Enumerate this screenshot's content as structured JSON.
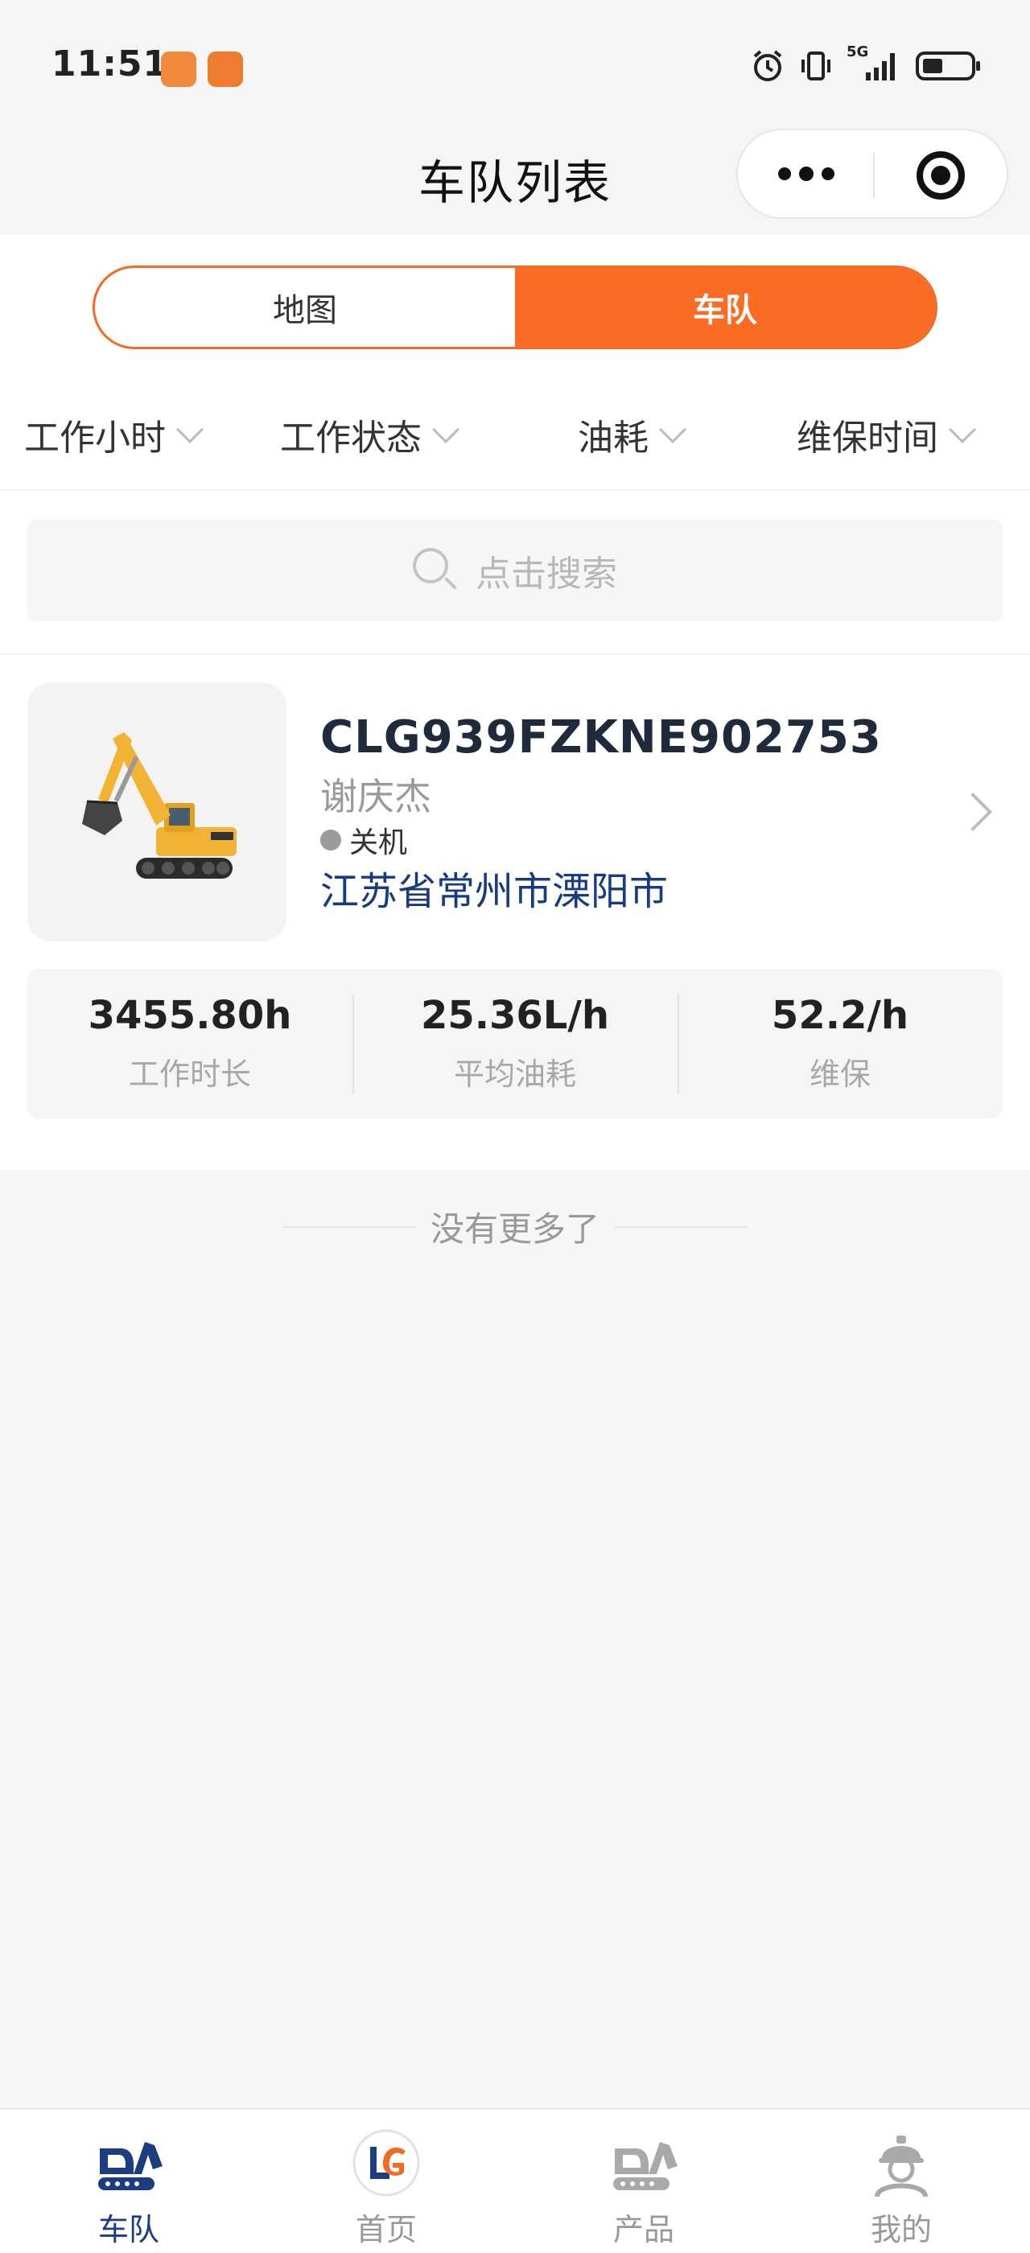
{
  "status_bar": {
    "time": "11:51",
    "network": "5G",
    "accent_app_color": "#f08a3a"
  },
  "nav": {
    "title": "车队列表",
    "capsule_more_icon": "more-dots-icon",
    "capsule_close_icon": "target-circle-icon"
  },
  "segment": {
    "options": [
      {
        "label": "地图",
        "active": false
      },
      {
        "label": "车队",
        "active": true
      }
    ],
    "active_color": "#fa6b23"
  },
  "filters": [
    {
      "label": "工作小时"
    },
    {
      "label": "工作状态"
    },
    {
      "label": "油耗"
    },
    {
      "label": "维保时间"
    }
  ],
  "search": {
    "placeholder": "点击搜索"
  },
  "fleet": [
    {
      "vin": "CLG939FZKNE902753",
      "owner": "谢庆杰",
      "state": "关机",
      "state_color": "#9a9a9a",
      "address": "江苏省常州市溧阳市",
      "stats": [
        {
          "value": "3455.80h",
          "label": "工作时长"
        },
        {
          "value": "25.36L/h",
          "label": "平均油耗"
        },
        {
          "value": "52.2/h",
          "label": "维保"
        }
      ]
    }
  ],
  "list_footer": "没有更多了",
  "tabbar": [
    {
      "label": "车队",
      "icon": "excavator-logo-icon",
      "active": true
    },
    {
      "label": "首页",
      "icon": "liugong-logo-icon",
      "active": false
    },
    {
      "label": "产品",
      "icon": "excavator-logo-gray-icon",
      "active": false
    },
    {
      "label": "我的",
      "icon": "worker-helmet-icon",
      "active": false
    }
  ]
}
